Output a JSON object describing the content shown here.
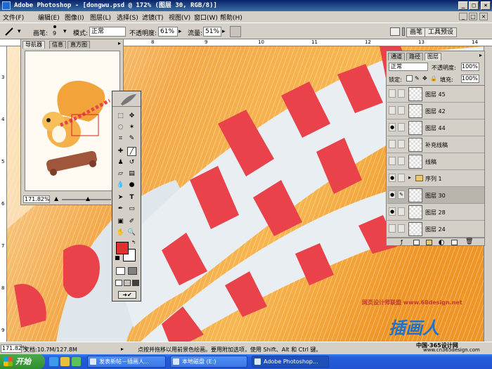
{
  "window": {
    "title": "Adobe Photoshop - [dongwu.psd @ 172% (图层 30, RGB/8)]",
    "min": "_",
    "max": "□",
    "close": "×"
  },
  "menu": {
    "items": [
      "文件(F)",
      "编辑(E)",
      "图像(I)",
      "图层(L)",
      "选择(S)",
      "滤镜(T)",
      "视图(V)",
      "窗口(W)",
      "帮助(H)"
    ],
    "doc_min": "_",
    "doc_max": "□",
    "doc_close": "×"
  },
  "options": {
    "brush_label": "画笔:",
    "brush_size": "9",
    "mode_label": "模式:",
    "mode_value": "正常",
    "opacity_label": "不透明度:",
    "opacity_value": "61%",
    "flow_label": "流量:",
    "flow_value": "51%",
    "dock_tabs": [
      "画笔",
      "工具预设"
    ]
  },
  "ruler": {
    "top_ticks": [
      "6",
      "7",
      "8",
      "9",
      "10",
      "11",
      "12",
      "13",
      "14"
    ],
    "left_ticks": [
      "3",
      "4",
      "5",
      "6",
      "7",
      "8",
      "9"
    ]
  },
  "navigator": {
    "tabs": [
      "导航器",
      "信息",
      "直方图"
    ],
    "zoom": "171.82%"
  },
  "layers": {
    "tabs": [
      "通道",
      "路径",
      "图层"
    ],
    "blend_mode": "正常",
    "opacity_label": "不透明度:",
    "opacity_value": "100%",
    "lock_label": "锁定:",
    "fill_label": "填充:",
    "fill_value": "100%",
    "rows": [
      {
        "name": "图层 45",
        "visible": false,
        "group": false,
        "selected": false
      },
      {
        "name": "图层 42",
        "visible": false,
        "group": false,
        "selected": false
      },
      {
        "name": "图层 44",
        "visible": true,
        "group": false,
        "selected": false
      },
      {
        "name": "补充线稿",
        "visible": false,
        "group": false,
        "selected": false
      },
      {
        "name": "线稿",
        "visible": false,
        "group": false,
        "selected": false
      },
      {
        "name": "序列 1",
        "visible": true,
        "group": true,
        "selected": false
      },
      {
        "name": "图层 30",
        "visible": true,
        "group": false,
        "selected": true
      },
      {
        "name": "图层 28",
        "visible": true,
        "group": false,
        "selected": false
      },
      {
        "name": "图层 24",
        "visible": false,
        "group": false,
        "selected": false
      }
    ]
  },
  "toolbox": {
    "foreground_color": "#e03030",
    "background_color": "#ffffff"
  },
  "status": {
    "zoom": "171.82%",
    "doc": "文档:10.7M/127.8M",
    "hint": "点按并拖移以用前景色绘画。要用附加选项，使用 Shift、Alt 和 Ctrl 键。"
  },
  "watermark": {
    "site1": "网页设计师联盟 www.68design.net",
    "brand": "插画人",
    "site2": "中国·365设计网",
    "site3": "www.cn365design.com"
  },
  "taskbar": {
    "start": "开始",
    "buttons": [
      "发表新帖－插画人...",
      "本地磁盘 (E:)",
      "Adobe Photoshop..."
    ]
  }
}
